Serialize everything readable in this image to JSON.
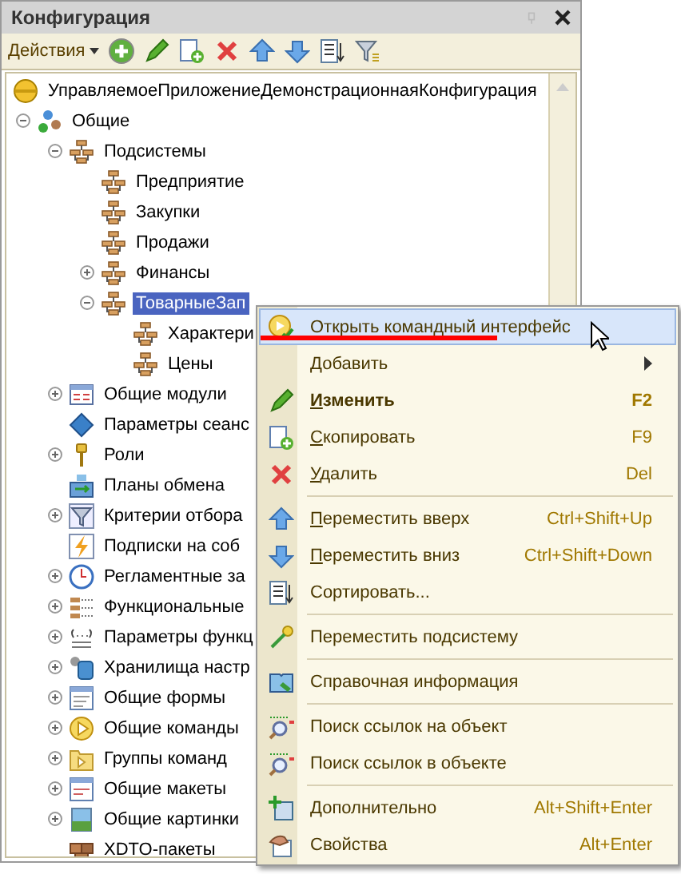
{
  "window": {
    "title": "Конфигурация"
  },
  "toolbar": {
    "actions_label": "Действия"
  },
  "tree": [
    {
      "label": "УправляемоеПриложениеДемонстрационнаяКонфигурация",
      "kind": "config",
      "selected": false,
      "children": [
        {
          "label": "Общие",
          "kind": "common",
          "expanded": true,
          "selected": false,
          "children": [
            {
              "label": "Подсистемы",
              "kind": "subsystem",
              "expanded": true,
              "selected": false,
              "children": [
                {
                  "label": "Предприятие",
                  "kind": "subsystem",
                  "selected": false
                },
                {
                  "label": "Закупки",
                  "kind": "subsystem",
                  "selected": false
                },
                {
                  "label": "Продажи",
                  "kind": "subsystem",
                  "selected": false
                },
                {
                  "label": "Финансы",
                  "kind": "subsystem",
                  "expanded": false,
                  "selected": false
                },
                {
                  "label": "ТоварныеЗап",
                  "kind": "subsystem",
                  "expanded": true,
                  "selected": true,
                  "children": [
                    {
                      "label": "Характери",
                      "kind": "subsystem",
                      "selected": false
                    },
                    {
                      "label": "Цены",
                      "kind": "subsystem",
                      "selected": false
                    }
                  ]
                }
              ]
            },
            {
              "label": "Общие модули",
              "kind": "module",
              "expanded": false,
              "selected": false
            },
            {
              "label": "Параметры сеанс",
              "kind": "param",
              "selected": false
            },
            {
              "label": "Роли",
              "kind": "role",
              "expanded": false,
              "selected": false
            },
            {
              "label": "Планы обмена",
              "kind": "exchange",
              "selected": false
            },
            {
              "label": "Критерии отбора",
              "kind": "filter",
              "expanded": false,
              "selected": false
            },
            {
              "label": "Подписки на соб",
              "kind": "event",
              "selected": false
            },
            {
              "label": "Регламентные за",
              "kind": "clock",
              "expanded": false,
              "selected": false
            },
            {
              "label": "Функциональные",
              "kind": "options",
              "expanded": false,
              "selected": false
            },
            {
              "label": "Параметры функц",
              "kind": "braces",
              "expanded": false,
              "selected": false
            },
            {
              "label": "Хранилища настр",
              "kind": "storage",
              "expanded": false,
              "selected": false
            },
            {
              "label": "Общие формы",
              "kind": "form",
              "expanded": false,
              "selected": false
            },
            {
              "label": "Общие команды",
              "kind": "command",
              "expanded": false,
              "selected": false
            },
            {
              "label": "Группы команд",
              "kind": "folder",
              "expanded": false,
              "selected": false
            },
            {
              "label": "Общие макеты",
              "kind": "layout",
              "expanded": false,
              "selected": false
            },
            {
              "label": "Общие картинки",
              "kind": "picture",
              "expanded": false,
              "selected": false
            },
            {
              "label": "XDTO-пакеты",
              "kind": "package",
              "selected": false
            }
          ]
        }
      ]
    }
  ],
  "context_menu": [
    {
      "kind": "open",
      "label": "Открыть командный интерфейс",
      "selected": true
    },
    {
      "kind": "add",
      "label": "Добавить",
      "submenu": true,
      "selected": false
    },
    {
      "kind": "edit",
      "label": "Изменить",
      "shortcut": "F2",
      "bold": true,
      "underline_first": true,
      "selected": false
    },
    {
      "kind": "copy",
      "label": "Скопировать",
      "shortcut": "F9",
      "underline_first": true,
      "selected": false
    },
    {
      "kind": "delete",
      "label": "Удалить",
      "shortcut": "Del",
      "underline_first": true,
      "selected": false
    },
    {
      "kind": "separator"
    },
    {
      "kind": "up",
      "label": "Переместить вверх",
      "shortcut": "Ctrl+Shift+Up",
      "underline_first": true,
      "selected": false
    },
    {
      "kind": "down",
      "label": "Переместить вниз",
      "shortcut": "Ctrl+Shift+Down",
      "underline_first": true,
      "selected": false
    },
    {
      "kind": "sort",
      "label": "Сортировать...",
      "selected": false
    },
    {
      "kind": "separator"
    },
    {
      "kind": "move",
      "label": "Переместить подсистему",
      "selected": false
    },
    {
      "kind": "separator"
    },
    {
      "kind": "help",
      "label": "Справочная информация",
      "selected": false
    },
    {
      "kind": "separator"
    },
    {
      "kind": "findto",
      "label": "Поиск ссылок на объект",
      "selected": false
    },
    {
      "kind": "findin",
      "label": "Поиск ссылок в объекте",
      "selected": false
    },
    {
      "kind": "separator"
    },
    {
      "kind": "more",
      "label": "Дополнительно",
      "shortcut": "Alt+Shift+Enter",
      "selected": false
    },
    {
      "kind": "props",
      "label": "Свойства",
      "shortcut": "Alt+Enter",
      "selected": false
    }
  ]
}
